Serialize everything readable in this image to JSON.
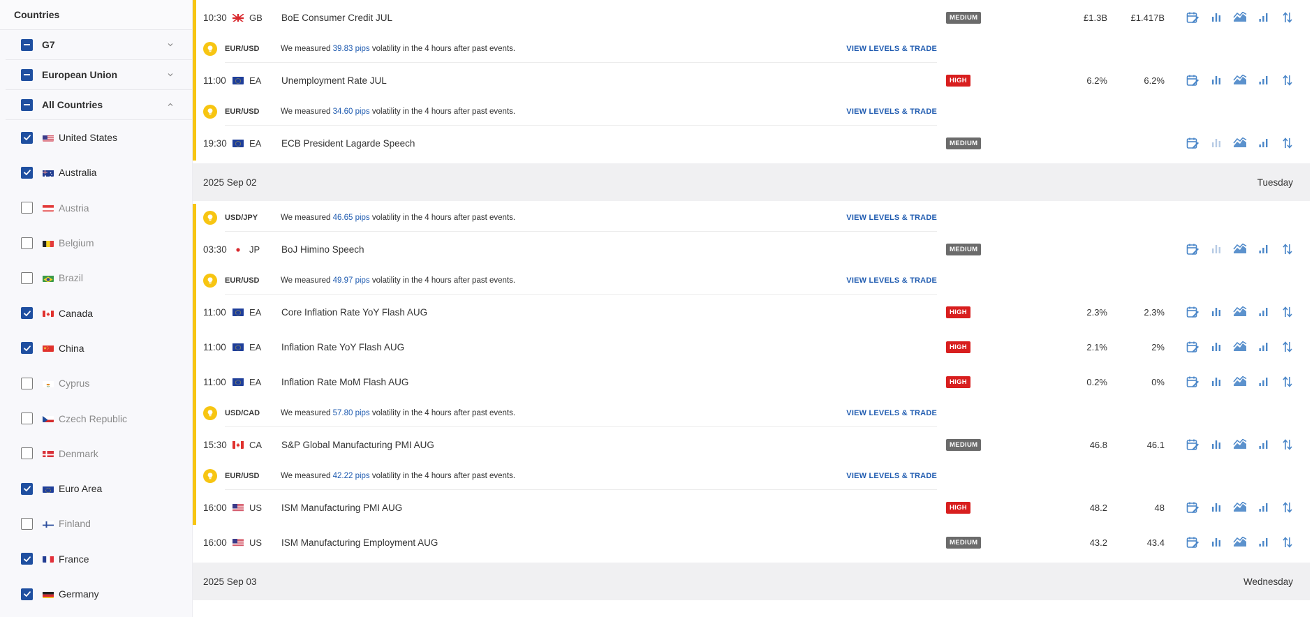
{
  "sidebar": {
    "title": "Countries",
    "groups": [
      {
        "label": "G7",
        "state": "partial",
        "expanded": false
      },
      {
        "label": "European Union",
        "state": "partial",
        "expanded": false
      },
      {
        "label": "All Countries",
        "state": "partial",
        "expanded": true
      }
    ],
    "countries": [
      {
        "name": "United States",
        "checked": true,
        "flag": "us"
      },
      {
        "name": "Australia",
        "checked": true,
        "flag": "au"
      },
      {
        "name": "Austria",
        "checked": false,
        "flag": "at"
      },
      {
        "name": "Belgium",
        "checked": false,
        "flag": "be"
      },
      {
        "name": "Brazil",
        "checked": false,
        "flag": "br"
      },
      {
        "name": "Canada",
        "checked": true,
        "flag": "ca"
      },
      {
        "name": "China",
        "checked": true,
        "flag": "cn"
      },
      {
        "name": "Cyprus",
        "checked": false,
        "flag": "cy"
      },
      {
        "name": "Czech Republic",
        "checked": false,
        "flag": "cz"
      },
      {
        "name": "Denmark",
        "checked": false,
        "flag": "dk"
      },
      {
        "name": "Euro Area",
        "checked": true,
        "flag": "eu"
      },
      {
        "name": "Finland",
        "checked": false,
        "flag": "fi"
      },
      {
        "name": "France",
        "checked": true,
        "flag": "fr"
      },
      {
        "name": "Germany",
        "checked": true,
        "flag": "de"
      }
    ]
  },
  "calendar": {
    "vol_prefix": "We measured",
    "vol_suffix": "volatility in the 4 hours after past events.",
    "vol_link": "VIEW LEVELS & TRADE",
    "rows": [
      {
        "kind": "event",
        "accent": true,
        "time": "10:30",
        "cc": "GB",
        "flag": "gb",
        "name": "BoE Consumer Credit JUL",
        "impact": "MEDIUM",
        "actual": "£1.3B",
        "consensus": "£1.417B",
        "chart_dim": false
      },
      {
        "kind": "vol",
        "pair": "EUR/USD",
        "pips": "39.83 pips"
      },
      {
        "kind": "event",
        "accent": true,
        "time": "11:00",
        "cc": "EA",
        "flag": "eu",
        "name": "Unemployment Rate JUL",
        "impact": "HIGH",
        "actual": "6.2%",
        "consensus": "6.2%",
        "chart_dim": false
      },
      {
        "kind": "vol",
        "pair": "EUR/USD",
        "pips": "34.60 pips"
      },
      {
        "kind": "event",
        "accent": true,
        "time": "19:30",
        "cc": "EA",
        "flag": "eu",
        "name": "ECB President Lagarde Speech",
        "impact": "MEDIUM",
        "actual": "",
        "consensus": "",
        "chart_dim": true
      },
      {
        "kind": "date",
        "date": "2025 Sep 02",
        "weekday": "Tuesday"
      },
      {
        "kind": "vol",
        "pair": "USD/JPY",
        "pips": "46.65 pips"
      },
      {
        "kind": "event",
        "accent": true,
        "time": "03:30",
        "cc": "JP",
        "flag": "jp",
        "name": "BoJ Himino Speech",
        "impact": "MEDIUM",
        "actual": "",
        "consensus": "",
        "chart_dim": true
      },
      {
        "kind": "vol",
        "pair": "EUR/USD",
        "pips": "49.97 pips"
      },
      {
        "kind": "event",
        "accent": true,
        "time": "11:00",
        "cc": "EA",
        "flag": "eu",
        "name": "Core Inflation Rate YoY Flash AUG",
        "impact": "HIGH",
        "actual": "2.3%",
        "consensus": "2.3%",
        "chart_dim": false
      },
      {
        "kind": "event",
        "accent": true,
        "time": "11:00",
        "cc": "EA",
        "flag": "eu",
        "name": "Inflation Rate YoY Flash AUG",
        "impact": "HIGH",
        "actual": "2.1%",
        "consensus": "2%",
        "chart_dim": false
      },
      {
        "kind": "event",
        "accent": true,
        "time": "11:00",
        "cc": "EA",
        "flag": "eu",
        "name": "Inflation Rate MoM Flash AUG",
        "impact": "HIGH",
        "actual": "0.2%",
        "consensus": "0%",
        "chart_dim": false
      },
      {
        "kind": "vol",
        "pair": "USD/CAD",
        "pips": "57.80 pips"
      },
      {
        "kind": "event",
        "accent": true,
        "time": "15:30",
        "cc": "CA",
        "flag": "ca",
        "name": "S&P Global Manufacturing PMI AUG",
        "impact": "MEDIUM",
        "actual": "46.8",
        "consensus": "46.1",
        "chart_dim": false
      },
      {
        "kind": "vol",
        "pair": "EUR/USD",
        "pips": "42.22 pips"
      },
      {
        "kind": "event",
        "accent": true,
        "time": "16:00",
        "cc": "US",
        "flag": "us",
        "name": "ISM Manufacturing PMI AUG",
        "impact": "HIGH",
        "actual": "48.2",
        "consensus": "48",
        "chart_dim": false
      },
      {
        "kind": "event",
        "accent": false,
        "time": "16:00",
        "cc": "US",
        "flag": "us",
        "name": "ISM Manufacturing Employment AUG",
        "impact": "MEDIUM",
        "actual": "43.2",
        "consensus": "43.4",
        "chart_dim": false
      },
      {
        "kind": "date",
        "date": "2025 Sep 03",
        "weekday": "Wednesday"
      }
    ]
  },
  "colors": {
    "accent": "#f7c512",
    "link": "#1f5bb0",
    "high": "#d81e1e",
    "medium": "#6b6b6b",
    "icon": "#4a86c8"
  }
}
